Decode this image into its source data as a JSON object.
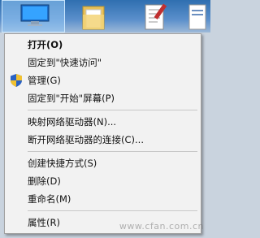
{
  "desktop": {
    "icons": [
      "computer-icon",
      "folder-icon",
      "notepad-icon",
      "document-icon"
    ]
  },
  "menu": {
    "open": "打开(O)",
    "pin_quick_access": "固定到\"快速访问\"",
    "manage": "管理(G)",
    "pin_start": "固定到\"开始\"屏幕(P)",
    "map_drive": "映射网络驱动器(N)...",
    "disconnect_drive": "断开网络驱动器的连接(C)...",
    "create_shortcut": "创建快捷方式(S)",
    "delete": "删除(D)",
    "rename": "重命名(M)",
    "properties": "属性(R)"
  },
  "watermark": "www.cfan.com.cn",
  "colors": {
    "menu_bg": "#f2f2f2",
    "menu_border": "#a0a0a0",
    "separator": "#c8c8c8",
    "desktop_blue": "#2f6fb0",
    "selection": "#96c8f5"
  }
}
